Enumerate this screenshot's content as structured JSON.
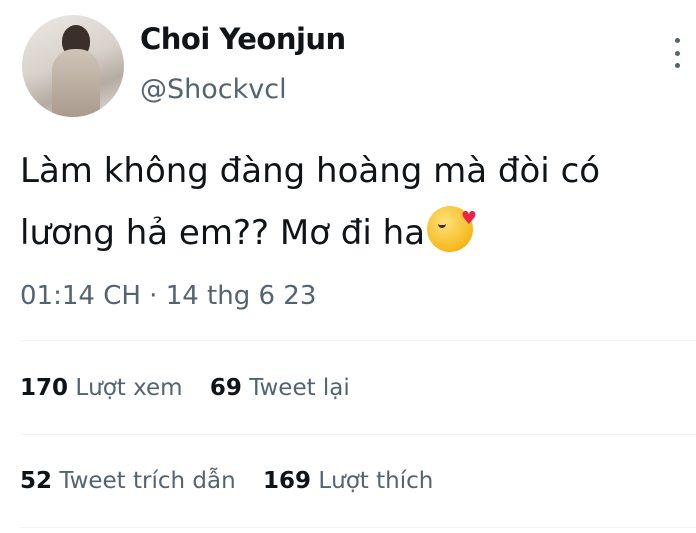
{
  "author": {
    "display_name": "Choi Yeonjun",
    "handle": "@Shockvcl"
  },
  "tweet": {
    "line1": "Làm không đàng hoàng mà đòi có",
    "line2": "lương hả em?? Mơ đi ha",
    "emoji": "face-blowing-a-kiss",
    "timestamp": "01:14 CH · 14 thg 6 23"
  },
  "stats": {
    "views_count": "170",
    "views_label": "Lượt xem",
    "retweets_count": "69",
    "retweets_label": "Tweet lại",
    "quotes_count": "52",
    "quotes_label": "Tweet trích dẫn",
    "likes_count": "169",
    "likes_label": "Lượt thích"
  },
  "colors": {
    "text_primary": "#0f1419",
    "text_secondary": "#536471",
    "divider": "#eff3f4"
  }
}
